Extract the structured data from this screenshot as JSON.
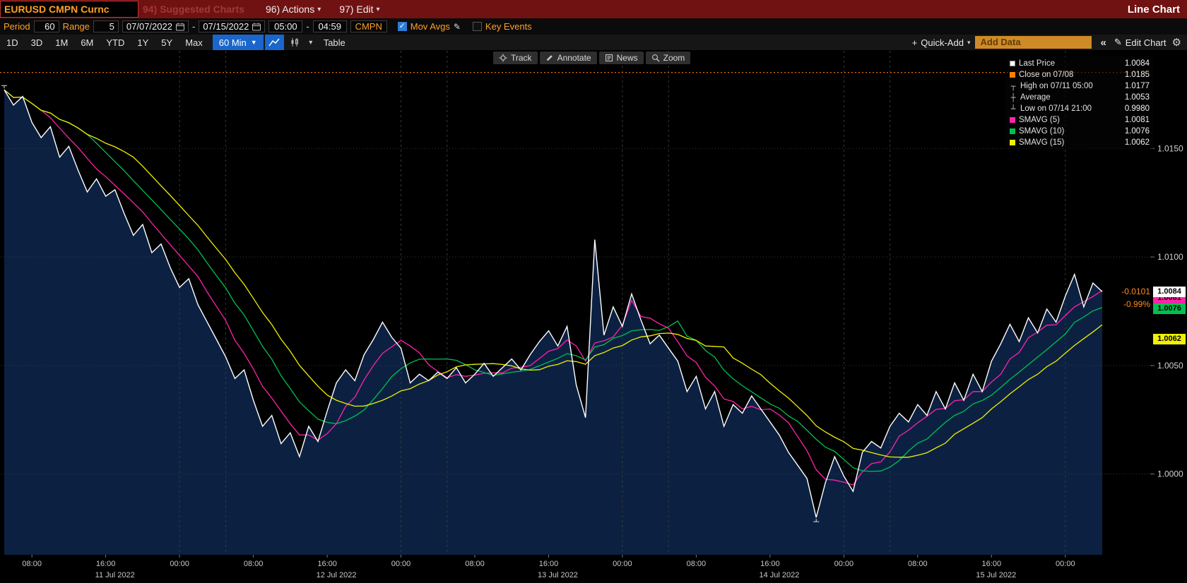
{
  "window": {
    "title_left": "EURUSD CMPN Curnc",
    "menu_suggested": "94) Suggested Charts",
    "menu_actions": "96) Actions",
    "menu_edit": "97) Edit",
    "title_right": "Line Chart"
  },
  "glyphs": {
    "caret_down": "▾",
    "caret_solid": "▼",
    "plus": "+",
    "collapse": "«",
    "pencil": "✎",
    "gear": "⚙",
    "check": "✓",
    "dash": "-"
  },
  "toolbar_fields": {
    "period_label": "Period",
    "period_value": "60",
    "range_label": "Range",
    "range_value": "5",
    "date_from": "07/07/2022",
    "date_to": "07/15/2022",
    "time_from": "05:00",
    "time_to": "04:59",
    "source": "CMPN",
    "mov_avgs_label": "Mov Avgs",
    "key_events_label": "Key Events"
  },
  "toolbar_tabs": {
    "ranges": [
      "1D",
      "3D",
      "1M",
      "6M",
      "YTD",
      "1Y",
      "5Y",
      "Max"
    ],
    "interval": "60 Min",
    "table_label": "Table",
    "track": "Track",
    "annotate": "Annotate",
    "news": "News",
    "zoom": "Zoom",
    "quick_add": "Quick-Add",
    "add_data_placeholder": "Add Data",
    "edit_chart": "Edit Chart"
  },
  "legend": {
    "rows": [
      {
        "id": "last-price",
        "label": "Last Price",
        "value": "1.0084",
        "swatch": "#ffffff",
        "glyph": null
      },
      {
        "id": "close",
        "label": "Close on 07/08",
        "value": "1.0185",
        "swatch": "#ff8000",
        "glyph": null
      },
      {
        "id": "high",
        "label": "High on 07/11 05:00",
        "value": "1.0177",
        "swatch": null,
        "glyph": "┬"
      },
      {
        "id": "average",
        "label": "Average",
        "value": "1.0053",
        "swatch": null,
        "glyph": "┼"
      },
      {
        "id": "low",
        "label": "Low on 07/14 21:00",
        "value": "0.9980",
        "swatch": null,
        "glyph": "┴"
      },
      {
        "id": "smavg-5",
        "label": "SMAVG (5)",
        "value": "1.0081",
        "swatch": "#ff22aa",
        "glyph": null
      },
      {
        "id": "smavg-10",
        "label": "SMAVG (10)",
        "value": "1.0076",
        "swatch": "#00c050",
        "glyph": null
      },
      {
        "id": "smavg-15",
        "label": "SMAVG (15)",
        "value": "1.0062",
        "swatch": "#f0f000",
        "glyph": null
      }
    ]
  },
  "axis_tags": [
    {
      "label": "1.0084",
      "price": 1.0084,
      "bg": "#ffffff",
      "fg": "#000000"
    },
    {
      "label": "1.0081",
      "price": 1.0081,
      "bg": "#ff22aa",
      "fg": "#000000"
    },
    {
      "label": "1.0076",
      "price": 1.0076,
      "bg": "#00c050",
      "fg": "#000000"
    },
    {
      "label": "1.0062",
      "price": 1.0062,
      "bg": "#f0f000",
      "fg": "#000000"
    }
  ],
  "annotations": {
    "change_abs": "-0.0101",
    "change_pct": "-0.99%"
  },
  "chart_data": {
    "type": "line",
    "title": "EURUSD CMPN Curncy — 60 Min Line Chart",
    "x_unit": "hour",
    "x_start": "2022-07-11 05:00",
    "prices": [
      1.0177,
      1.017,
      1.0174,
      1.0162,
      1.0155,
      1.016,
      1.0146,
      1.0151,
      1.014,
      1.013,
      1.0136,
      1.0128,
      1.0131,
      1.012,
      1.011,
      1.0115,
      1.0102,
      1.0106,
      1.0095,
      1.0086,
      1.009,
      1.0078,
      1.007,
      1.0062,
      1.0054,
      1.0044,
      1.0048,
      1.0034,
      1.0022,
      1.0027,
      1.0014,
      1.0019,
      1.0008,
      1.0022,
      1.0015,
      1.0029,
      1.0042,
      1.0048,
      1.0043,
      1.0055,
      1.0062,
      1.007,
      1.0063,
      1.0058,
      1.0042,
      1.0046,
      1.0043,
      1.0047,
      1.0044,
      1.0049,
      1.0042,
      1.0046,
      1.0051,
      1.0045,
      1.0049,
      1.0053,
      1.0048,
      1.0055,
      1.0061,
      1.0066,
      1.0059,
      1.0068,
      1.0041,
      1.0026,
      1.0108,
      1.0064,
      1.0077,
      1.0068,
      1.0083,
      1.0071,
      1.006,
      1.0064,
      1.0058,
      1.0052,
      1.0038,
      1.0045,
      1.003,
      1.0038,
      1.0022,
      1.0032,
      1.0028,
      1.0036,
      1.003,
      1.0024,
      1.0018,
      1.001,
      1.0004,
      0.9998,
      0.998,
      0.9996,
      1.0008,
      0.9999,
      0.9992,
      1.001,
      1.0015,
      1.0012,
      1.0022,
      1.0028,
      1.0024,
      1.0032,
      1.0027,
      1.0038,
      1.003,
      1.0042,
      1.0034,
      1.0046,
      1.0038,
      1.0052,
      1.006,
      1.0069,
      1.0061,
      1.0072,
      1.0065,
      1.0076,
      1.007,
      1.0082,
      1.0092,
      1.0077,
      1.0088,
      1.0084
    ],
    "smavg": [
      {
        "name": "SMAVG (5)",
        "window": 5,
        "color": "#ff22aa"
      },
      {
        "name": "SMAVG (10)",
        "window": 10,
        "color": "#00c050"
      },
      {
        "name": "SMAVG (15)",
        "window": 15,
        "color": "#f0f000"
      }
    ],
    "close_value": 1.0185,
    "last_price": 1.0084,
    "high": {
      "value": 1.0177,
      "time": "07/11 05:00"
    },
    "low": {
      "value": 0.998,
      "time": "07/14 21:00"
    },
    "average": 1.0053,
    "ylim": [
      0.99628,
      1.0195
    ],
    "y_ticks": [
      1.015,
      1.01,
      1.005,
      1.0
    ],
    "x_time_ticks": [
      {
        "i": 3,
        "label": "08:00"
      },
      {
        "i": 11,
        "label": "16:00"
      },
      {
        "i": 19,
        "label": "00:00"
      },
      {
        "i": 27,
        "label": "08:00"
      },
      {
        "i": 35,
        "label": "16:00"
      },
      {
        "i": 43,
        "label": "00:00"
      },
      {
        "i": 51,
        "label": "08:00"
      },
      {
        "i": 59,
        "label": "16:00"
      },
      {
        "i": 67,
        "label": "00:00"
      },
      {
        "i": 75,
        "label": "08:00"
      },
      {
        "i": 83,
        "label": "16:00"
      },
      {
        "i": 91,
        "label": "00:00"
      },
      {
        "i": 99,
        "label": "08:00"
      },
      {
        "i": 107,
        "label": "16:00"
      },
      {
        "i": 115,
        "label": "00:00"
      }
    ],
    "x_date_labels": [
      {
        "label": "11 Jul 2022",
        "start": 0,
        "end": 24
      },
      {
        "label": "12 Jul 2022",
        "start": 24,
        "end": 48
      },
      {
        "label": "13 Jul 2022",
        "start": 48,
        "end": 72
      },
      {
        "label": "14 Jul 2022",
        "start": 72,
        "end": 96
      },
      {
        "label": "15 Jul 2022",
        "start": 96,
        "end": 119
      }
    ],
    "v_gridlines_i": [
      19,
      24,
      43,
      48,
      67,
      72,
      91,
      96,
      115
    ],
    "grid": true,
    "legend_position": "top-right",
    "colors": {
      "price": "#ffffff",
      "fill": "#0c2142",
      "close_line": "#ff8000",
      "grid": "#3a3a3a",
      "vgrid": "#383838",
      "axis_text": "#c8c8c8"
    }
  }
}
